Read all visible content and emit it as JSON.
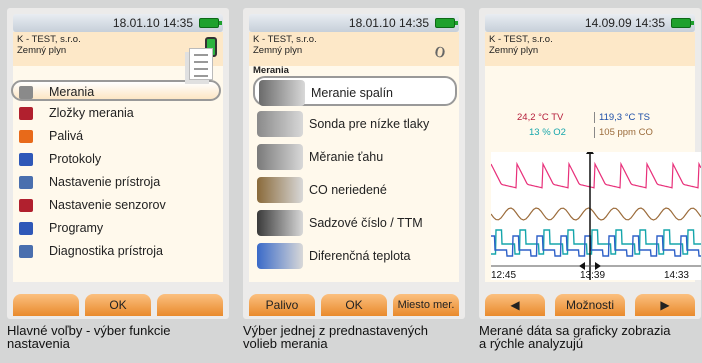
{
  "colors": {
    "orange_button": "#e98a2c",
    "battery_green": "#1ea12c",
    "trace_pink": "#e8307a",
    "trace_teal": "#16a6ab",
    "trace_blue": "#2e60c8",
    "trace_brown": "#9b6b3a",
    "tv_red": "#b51d3a",
    "ts_blue": "#1d4fa8"
  },
  "panel1": {
    "status": "18.01.10 14:35",
    "company": "K - TEST, s.r.o.",
    "fuel": "Zemný plyn",
    "items": [
      {
        "label": "Merania",
        "icon": "measuring-device-icon"
      },
      {
        "label": "Zložky merania",
        "icon": "components-icon"
      },
      {
        "label": "Palivá",
        "icon": "flame-icon"
      },
      {
        "label": "Protokoly",
        "icon": "floppy-icon"
      },
      {
        "label": "Nastavenie prístroja",
        "icon": "device-settings-icon"
      },
      {
        "label": "Nastavenie senzorov",
        "icon": "sensor-icon"
      },
      {
        "label": "Programy",
        "icon": "floppy-icon"
      },
      {
        "label": "Diagnostika prístroja",
        "icon": "device-diagnostic-icon"
      }
    ],
    "buttons": [
      "",
      "OK",
      ""
    ],
    "caption": [
      "Hlavné voľby - výber funkcie",
      "nastavenia"
    ]
  },
  "panel2": {
    "status": "18.01.10 14:35",
    "company": "K - TEST, s.r.o.",
    "fuel": "Zemný plyn",
    "section": "Merania",
    "items": [
      {
        "label": "Meranie spalín",
        "icon": "flue-probe-icon"
      },
      {
        "label": "Sonda pre nízke tlaky",
        "icon": "low-pressure-probe-icon"
      },
      {
        "label": "Měranie ťahu",
        "icon": "draft-probe-icon"
      },
      {
        "label": "CO neriedené",
        "icon": "co-probe-icon"
      },
      {
        "label": "Sadzové číslo / TTM",
        "icon": "smoke-pump-icon"
      },
      {
        "label": "Diferenčná teplota",
        "icon": "temperature-probes-icon"
      }
    ],
    "buttons": [
      "Palivo",
      "OK",
      "Miesto mer."
    ],
    "caption": [
      "Výber jednej z prednastavených",
      "volieb merania"
    ]
  },
  "panel3": {
    "status": "14.09.09 14:35",
    "company": "K - TEST, s.r.o.",
    "fuel": "Zemný plyn",
    "r1a": "24,2 °C TV",
    "r1b": "119,3 °C TS",
    "r2a": "13 % O2",
    "r2b": "105 ppm CO",
    "times": [
      "12:45",
      "13:39",
      "14:33"
    ],
    "buttons": [
      "◀",
      "Možnosti",
      "▶"
    ],
    "caption": [
      "Merané dáta sa graficky zobrazia",
      "a rýchle analyzujú"
    ]
  }
}
